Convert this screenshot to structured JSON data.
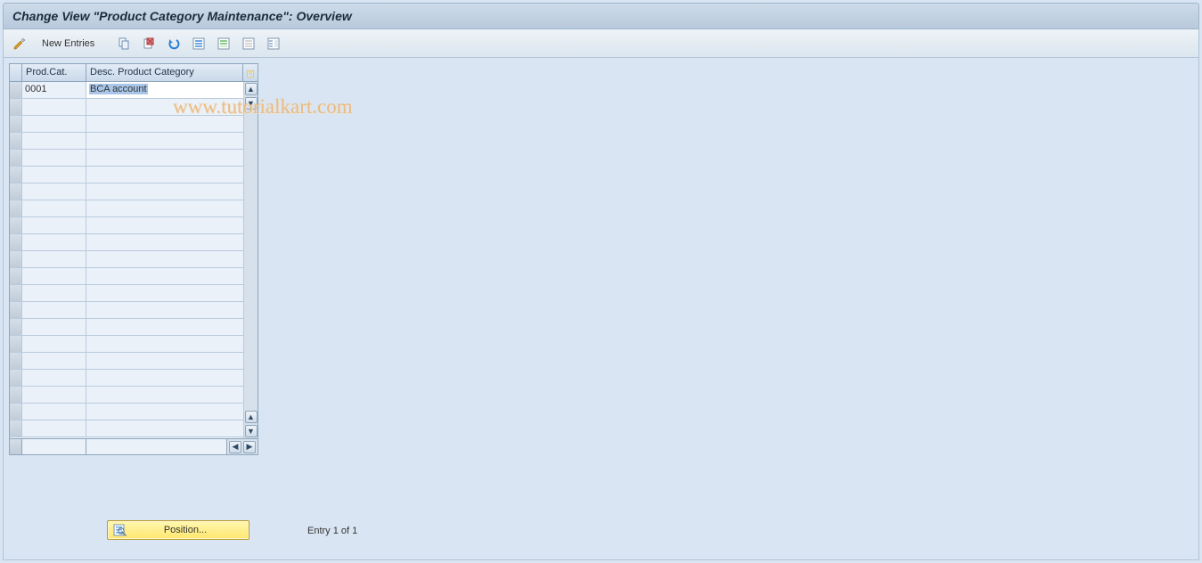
{
  "header": {
    "title": "Change View \"Product Category Maintenance\": Overview"
  },
  "toolbar": {
    "new_entries_label": "New Entries"
  },
  "table": {
    "columns": {
      "prod_cat": "Prod.Cat.",
      "desc": "Desc. Product Category"
    },
    "rows": [
      {
        "prod_cat": "0001",
        "desc": "BCA account"
      }
    ],
    "empty_row_count": 20
  },
  "footer": {
    "position_label": "Position...",
    "entry_status": "Entry 1 of 1"
  },
  "watermark": "www.tutorialkart.com"
}
